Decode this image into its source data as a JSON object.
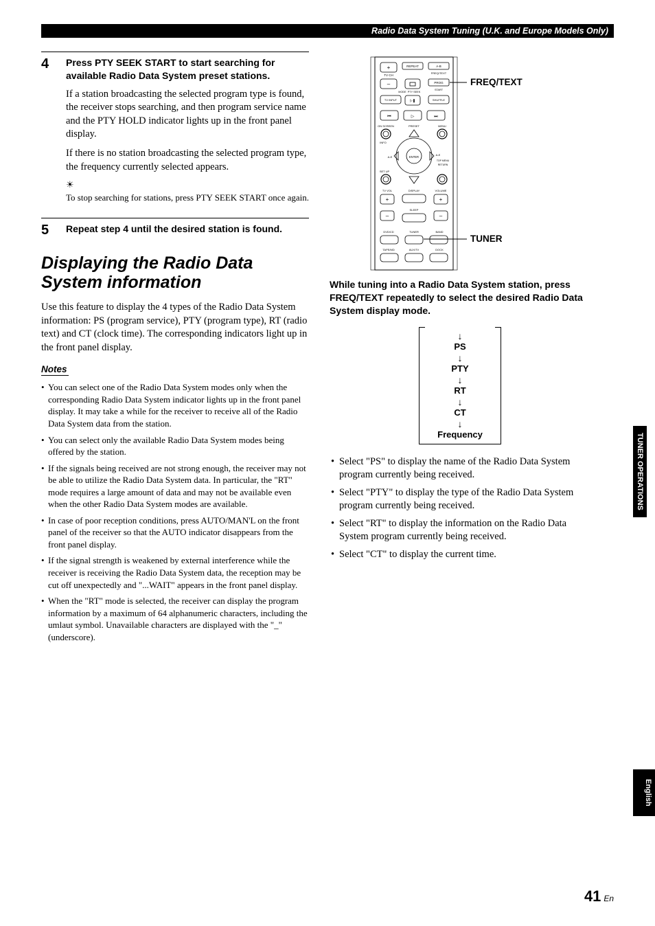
{
  "header": "Radio Data System Tuning (U.K. and Europe Models Only)",
  "step4": {
    "num": "4",
    "title": "Press PTY SEEK START to start searching for available Radio Data System preset stations.",
    "para1": "If a station broadcasting the selected program type is found, the receiver stops searching, and then program service name and the PTY HOLD indicator lights up in the front panel display.",
    "para2": "If there is no station broadcasting the selected program type, the frequency currently selected appears.",
    "tip": "To stop searching for stations, press PTY SEEK START once again."
  },
  "step5": {
    "num": "5",
    "title": "Repeat step 4 until the desired station is found."
  },
  "sectionHeading": "Displaying the Radio Data System information",
  "sectionIntro": "Use this feature to display the 4 types of the Radio Data System information: PS (program service), PTY (program type), RT (radio text) and CT (clock time). The corresponding indicators light up in the front panel display.",
  "notesLabel": "Notes",
  "notes": [
    "You can select one of the Radio Data System modes only when the corresponding Radio Data System indicator lights up in the front panel display. It may take a while for the receiver to receive all of the Radio Data System data from the station.",
    "You can select only the available Radio Data System modes being offered by the station.",
    "If the signals being received are not strong enough, the receiver may not be able to utilize the Radio Data System data. In particular, the \"RT\" mode requires a large amount of data and may not be available even when the other Radio Data System modes are available.",
    "In case of poor reception conditions, press AUTO/MAN'L on the front panel of the receiver so that the AUTO indicator disappears from the front panel display.",
    "If the signal strength is weakened by external interference while the receiver is receiving the Radio Data System data, the reception may be cut off unexpectedly and \"...WAIT\" appears in the front panel display.",
    "When the \"RT\" mode is selected, the receiver can display the program information by a maximum of 64 alphanumeric characters, including the umlaut symbol. Unavailable characters are displayed with the \"_\" (underscore)."
  ],
  "callouts": {
    "freqtext": "FREQ/TEXT",
    "tuner": "TUNER"
  },
  "remote": {
    "labels": {
      "tvch": "TV CH",
      "repeat": "REPEAT",
      "ab": "A-B",
      "freqtext": "FREQ/TEXT",
      "prog": "PROG",
      "mode": "MODE",
      "ptyseek": "PTY SEEK",
      "start": "START",
      "tvinput": "TV INPUT",
      "shuffle": "SHUFFLE",
      "onscreen": "ON SCREEN",
      "preset": "PRESET",
      "menu": "MENU",
      "info": "INFO",
      "ae_l": "A-E",
      "enter": "ENTER",
      "ae_r": "A-E",
      "topmenu": "TOP MENU",
      "return": "RETURN",
      "setup": "SET UP",
      "tvvol": "TV VOL",
      "display": "DISPLAY",
      "volume": "VOLUME",
      "sleep": "SLEEP",
      "dvdcd": "DVD/CD",
      "tuner": "TUNER",
      "band": "BAND",
      "tapemd": "TAPE/MD",
      "auxtv": "AUX/TV",
      "dock": "DOCK"
    }
  },
  "freqInstr": "While tuning into a Radio Data System station, press FREQ/TEXT repeatedly to select the desired Radio Data System display mode.",
  "modes": {
    "ps": "PS",
    "pty": "PTY",
    "rt": "RT",
    "ct": "CT",
    "freq": "Frequency"
  },
  "actions": [
    "Select \"PS\" to display the name of the Radio Data System program currently being received.",
    "Select \"PTY\" to display the type of the Radio Data System program currently being received.",
    "Select \"RT\" to display the information on the Radio Data System program currently being received.",
    "Select \"CT\" to display the current time."
  ],
  "sidebar": {
    "tunerOps": "TUNER OPERATIONS",
    "english": "English"
  },
  "pageNumber": {
    "num": "41",
    "lang": "En"
  }
}
